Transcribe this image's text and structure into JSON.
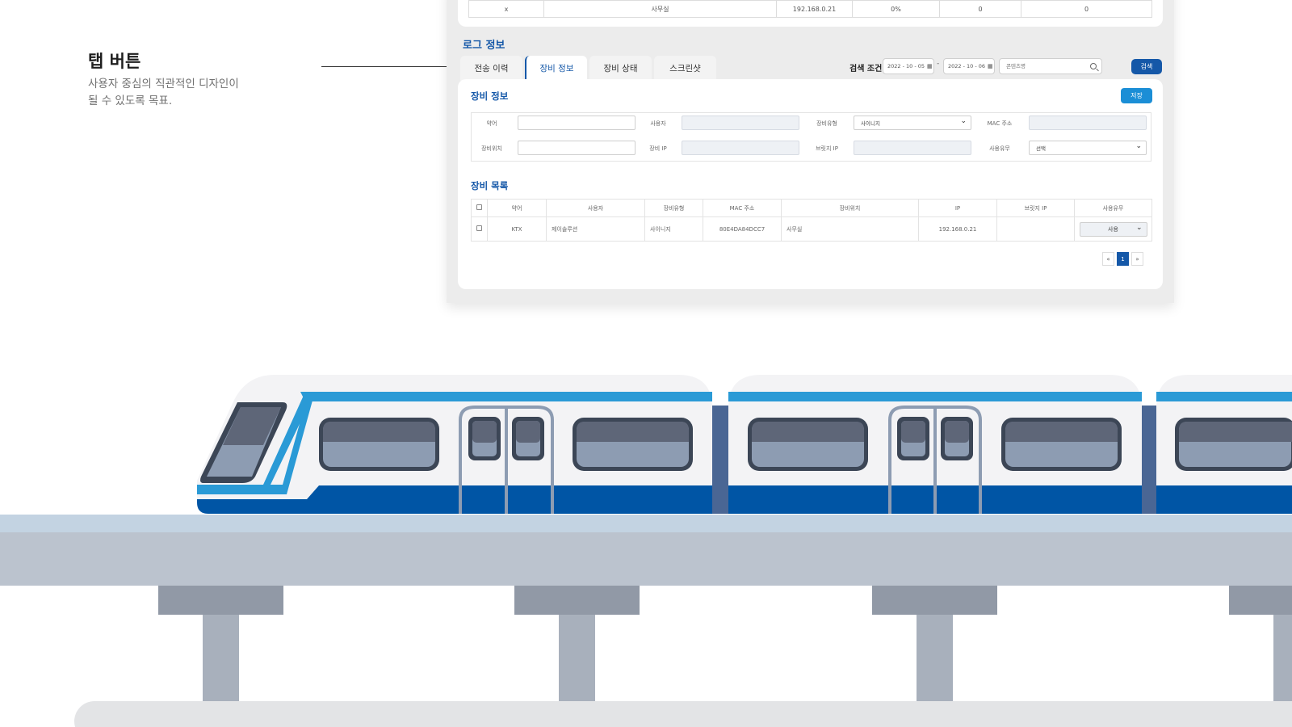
{
  "annotation": {
    "title": "탭 버튼",
    "desc_line1": "사용자 중심의 직관적인 디자인이",
    "desc_line2": "될 수 있도록 목표."
  },
  "top_row": {
    "cells": [
      "x",
      "사무실",
      "192.168.0.21",
      "0%",
      "0",
      "0"
    ]
  },
  "log_section": {
    "title": "로그 정보",
    "tabs": [
      {
        "label": "전송 이력",
        "active": false
      },
      {
        "label": "장비 정보",
        "active": true
      },
      {
        "label": "장비 상태",
        "active": false
      },
      {
        "label": "스크린샷",
        "active": false
      }
    ]
  },
  "search": {
    "label": "검색 조건",
    "date_from": "2022 - 10 - 05",
    "date_to": "2022 - 10 - 06",
    "separator": "-",
    "placeholder": "콘텐츠명",
    "button": "검색"
  },
  "equip_info": {
    "title": "장비 정보",
    "save_button": "저장",
    "fields": {
      "abbr": "약어",
      "user": "사용자",
      "type": "장비유형",
      "type_value": "사이니지",
      "mac": "MAC 주소",
      "location": "장비위치",
      "ip": "장비 IP",
      "bridge_ip": "브릿지 IP",
      "usage": "사용유무",
      "usage_value": "선택"
    }
  },
  "equip_list": {
    "title": "장비 목록",
    "headers": [
      "약어",
      "사용자",
      "장비유형",
      "MAC 주소",
      "장비위치",
      "IP",
      "브릿지 IP",
      "사용유무"
    ],
    "rows": [
      {
        "abbr": "KTX",
        "user": "제이솔루션",
        "type": "사이니지",
        "mac": "80E4DA84DCC7",
        "location": "사무실",
        "ip": "192.168.0.21",
        "bridge_ip": "",
        "usage": "사용"
      }
    ]
  },
  "pagination": {
    "prev": "«",
    "current": "1",
    "next": "»"
  },
  "colors": {
    "primary": "#1558a8",
    "accent": "#1b8ed6",
    "train_blue": "#0055a5",
    "train_stripe": "#2a9ad6"
  }
}
